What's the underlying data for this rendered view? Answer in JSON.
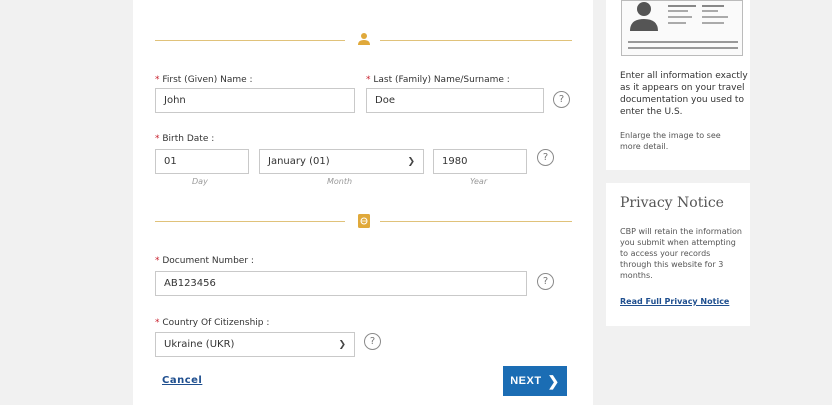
{
  "personal": {
    "first_name_label": "First (Given) Name :",
    "first_name_value": "John",
    "last_name_label": "Last (Family) Name/Surname :",
    "last_name_value": "Doe",
    "birth_date_label": "Birth Date :",
    "day_value": "01",
    "month_value": "January (01)",
    "year_value": "1980",
    "day_sublabel": "Day",
    "month_sublabel": "Month",
    "year_sublabel": "Year"
  },
  "document": {
    "number_label": "Document Number :",
    "number_value": "AB123456",
    "country_label": "Country Of Citizenship :",
    "country_value": "Ukraine (UKR)"
  },
  "required_marker": "*",
  "help_glyph": "?",
  "actions": {
    "cancel_label": "Cancel",
    "next_label": "NEXT"
  },
  "sidebar": {
    "instruction_text": "Enter all information exactly as it appears on your travel documentation you used to enter the U.S.",
    "enlarge_text": "Enlarge the image to see more detail.",
    "privacy_title": "Privacy Notice",
    "privacy_text": "CBP will retain the information you submit when attempting to access your records through this website for 3 months.",
    "privacy_link": "Read Full Privacy Notice"
  },
  "colors": {
    "accent_gold": "#e0c27a",
    "primary_blue": "#1b6db4",
    "required_red": "#c8202d"
  }
}
